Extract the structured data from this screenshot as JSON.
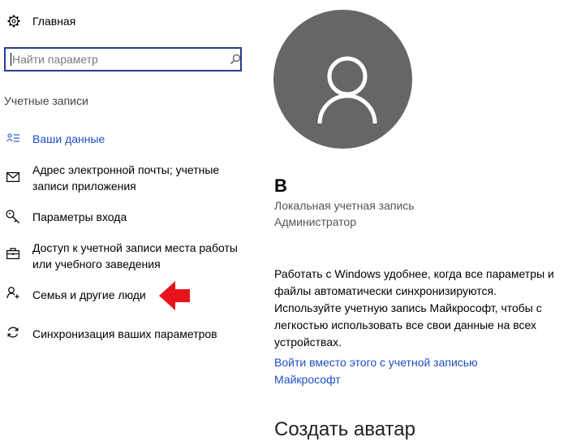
{
  "home": {
    "label": "Главная",
    "icon": "gear-icon"
  },
  "search": {
    "placeholder": "Найти параметр",
    "icon": "search-icon"
  },
  "section_title": "Учетные записи",
  "nav": {
    "items": [
      {
        "label": "Ваши данные",
        "icon": "person-card-icon",
        "active": true
      },
      {
        "label": "Адрес электронной почты; учетные записи приложения",
        "icon": "mail-icon"
      },
      {
        "label": "Параметры входа",
        "icon": "key-icon"
      },
      {
        "label": "Доступ к учетной записи места работы или учебного заведения",
        "icon": "briefcase-icon"
      },
      {
        "label": "Семья и другие люди",
        "icon": "person-add-icon"
      },
      {
        "label": "Синхронизация ваших параметров",
        "icon": "sync-icon"
      }
    ]
  },
  "profile": {
    "name": "В",
    "account_type": "Локальная учетная запись",
    "role": "Администратор"
  },
  "info": {
    "text": "Работать с Windows удобнее, когда все параметры и файлы автоматически синхронизируются. Используйте учетную запись Майкрософт, чтобы с легкостью использовать все свои данные на всех устройствах.",
    "link": "Войти вместо этого с учетной записью Майкрософт"
  },
  "avatar_section_title": "Создать аватар",
  "colors": {
    "accent": "#1f4fc4",
    "avatar_bg": "#666666",
    "arrow": "#e8141c"
  }
}
